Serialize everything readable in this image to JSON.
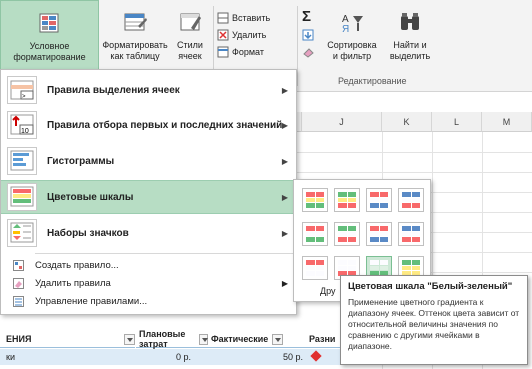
{
  "ribbon": {
    "cond_format": {
      "line1": "Условное",
      "line2": "форматирование"
    },
    "format_table": {
      "line1": "Форматировать",
      "line2": "как таблицу"
    },
    "cell_styles": {
      "line1": "Стили",
      "line2": "ячеек"
    },
    "insert": "Вставить",
    "delete": "Удалить",
    "format": "Формат",
    "sort": {
      "line1": "Сортировка",
      "line2": "и фильтр"
    },
    "find": {
      "line1": "Найти и",
      "line2": "выделить"
    },
    "editing_group": "Редактирование"
  },
  "columns": [
    "J",
    "K",
    "L",
    "M"
  ],
  "menu": {
    "items": [
      {
        "label": "Правила выделения ячеек"
      },
      {
        "label": "Правила отбора первых и последних значений"
      },
      {
        "label": "Гистограммы"
      },
      {
        "label": "Цветовые шкалы"
      },
      {
        "label": "Наборы значков"
      }
    ],
    "small_items": [
      {
        "label": "Создать правило..."
      },
      {
        "label": "Удалить правила"
      },
      {
        "label": "Управление правилами..."
      }
    ]
  },
  "submenu": {
    "other_label": "Дру"
  },
  "tooltip": {
    "title": "Цветовая шкала \"Белый-зеленый\"",
    "body": "Применение цветного градиента к диапазону ячеек. Оттенок цвета зависит от относительной величины значения по сравнению с другими ячейками в диапазоне."
  },
  "table": {
    "headers": [
      "ЕНИЯ",
      "Плановые затрат",
      "Фактические",
      "Разни"
    ],
    "row": {
      "label": "ки",
      "planned": "0 р.",
      "actual": "50 р."
    }
  },
  "colors": {
    "accent": "#b7ddc4",
    "selected_border": "#7bbf93"
  }
}
